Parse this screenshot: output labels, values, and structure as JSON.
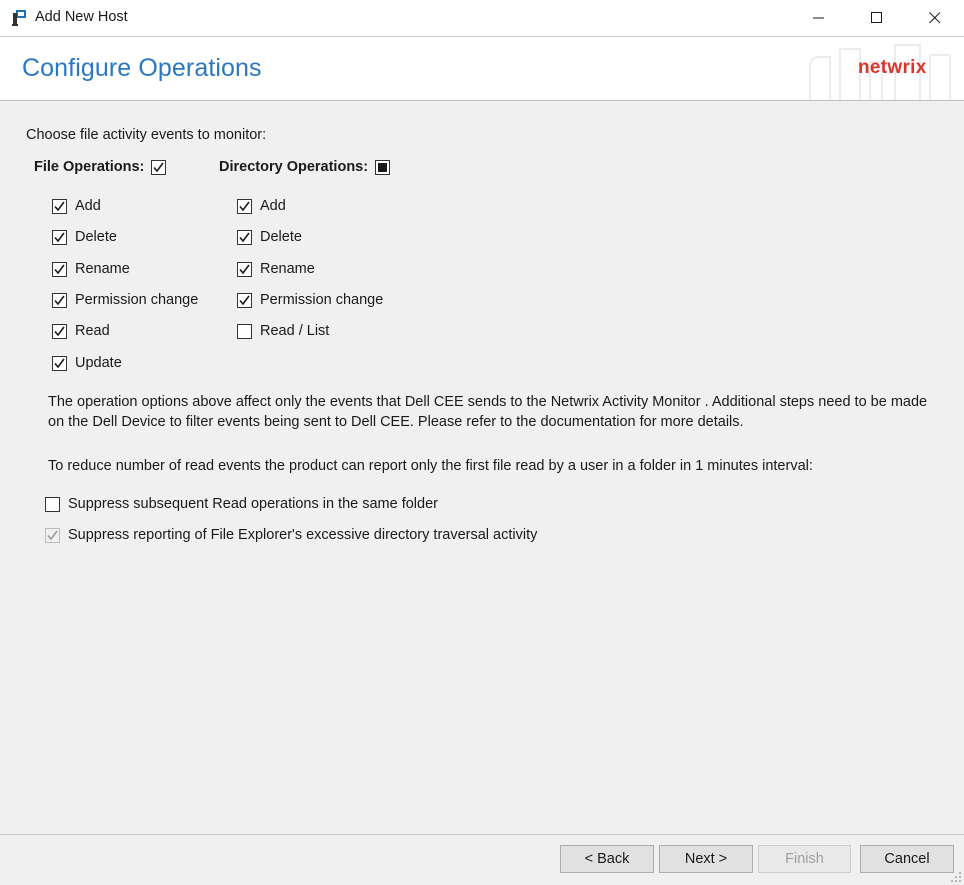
{
  "window": {
    "title": "Add New Host"
  },
  "header": {
    "page_title": "Configure Operations",
    "logo_text": "netwrix"
  },
  "content": {
    "prompt": "Choose file activity events to monitor:",
    "file_operations": {
      "label": "File Operations:",
      "state": "checked",
      "items": [
        {
          "label": "Add",
          "checked": true
        },
        {
          "label": "Delete",
          "checked": true
        },
        {
          "label": "Rename",
          "checked": true
        },
        {
          "label": "Permission change",
          "checked": true
        },
        {
          "label": "Read",
          "checked": true
        },
        {
          "label": "Update",
          "checked": true
        }
      ]
    },
    "directory_operations": {
      "label": "Directory Operations:",
      "state": "indeterminate",
      "items": [
        {
          "label": "Add",
          "checked": true
        },
        {
          "label": "Delete",
          "checked": true
        },
        {
          "label": "Rename",
          "checked": true
        },
        {
          "label": "Permission change",
          "checked": true
        },
        {
          "label": "Read / List",
          "checked": false
        }
      ]
    },
    "info_text": "The operation options above affect only the events that Dell CEE sends to the Netwrix Activity Monitor . Additional steps need to be made on the Dell Device to filter events being sent to Dell CEE. Please refer to the documentation for more details.",
    "reduce_text": "To reduce number of read events the product can report only the first file read by a user in a folder in 1 minutes interval:",
    "suppress_read": {
      "label": "Suppress subsequent Read operations in the same folder",
      "checked": false,
      "enabled": true
    },
    "suppress_traversal": {
      "label": "Suppress reporting of File Explorer's excessive directory traversal activity",
      "checked": true,
      "enabled": false
    }
  },
  "footer": {
    "back_label": "< Back",
    "next_label": "Next >",
    "finish_label": "Finish",
    "cancel_label": "Cancel"
  },
  "colors": {
    "title_blue": "#2b78c2",
    "logo_red": "#d9352b",
    "content_bg": "#f0f0f0"
  }
}
